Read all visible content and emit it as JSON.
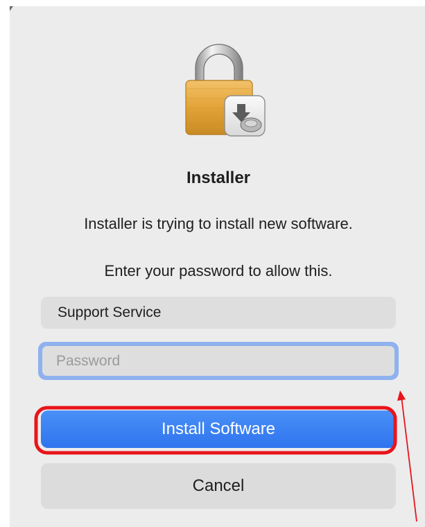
{
  "dialog": {
    "title": "Installer",
    "message": "Installer is trying to install new software.",
    "prompt": "Enter your password to allow this.",
    "username_value": "Support Service",
    "password_placeholder": "Password",
    "install_label": "Install Software",
    "cancel_label": "Cancel",
    "icon": "installer-lock-icon"
  },
  "annotations": {
    "highlight_color": "#e8141c",
    "arrow_color": "#e8141c"
  },
  "colors": {
    "accent": "#2f74ee",
    "focus_ring": "#8fb1ee",
    "background": "#ececec"
  }
}
